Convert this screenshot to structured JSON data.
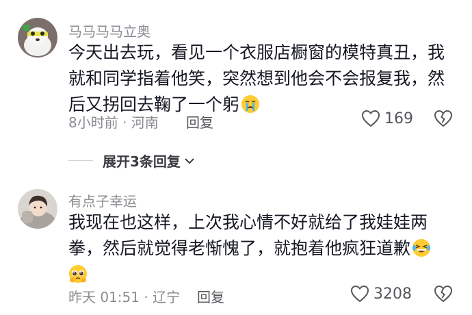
{
  "comments": [
    {
      "username": "马马马马立奥",
      "text": "今天出去玩，看见一个衣服店橱窗的模特真丑，我就和同学指着他笑，突然想到他会不会报复我，然后又拐回去鞠了一个躬",
      "emojis": [
        "crying-face-emoji"
      ],
      "time_location": "8小时前 · 河南",
      "reply_label": "回复",
      "likes": "169"
    },
    {
      "username": "有点子幸运",
      "text": "我现在也这样，上次我心情不好就给了我娃娃两拳，然后就觉得老惭愧了，就抱着他疯狂道歉",
      "emojis": [
        "laughing-tears-emoji",
        "pleading-face-emoji"
      ],
      "time_location": "昨天 01:51 · 辽宁",
      "reply_label": "回复",
      "likes": "3208"
    }
  ],
  "expand_replies": {
    "label": "展开3条回复"
  },
  "colors": {
    "primary_text": "#161823",
    "secondary_text": "#8a8b91",
    "action_text": "#55565c"
  },
  "icons": {
    "like": "heart-outline-icon",
    "dislike": "broken-heart-icon",
    "expand": "chevron-down-icon"
  }
}
